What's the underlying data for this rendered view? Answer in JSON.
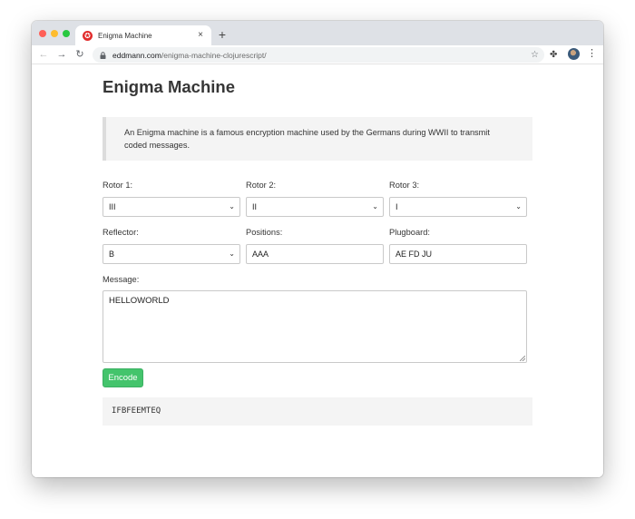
{
  "browser": {
    "tab_title": "Enigma Machine",
    "tab_close": "×",
    "new_tab": "+",
    "url_host": "eddmann.com",
    "url_path": "/enigma-machine-clojurescript/",
    "icons": {
      "back": "arrow-left",
      "forward": "arrow-right",
      "reload": "reload",
      "lock": "lock",
      "bookmark": "star",
      "extensions": "puzzle",
      "profile": "avatar",
      "menu": "kebab-menu"
    },
    "glyphs": {
      "back": "←",
      "forward": "→",
      "reload": "↻",
      "star": "☆",
      "ext": "✤",
      "menu": "⋮",
      "favicon": "✪"
    }
  },
  "page": {
    "title": "Enigma Machine",
    "intro": "An Enigma machine is a famous encryption machine used by the Germans during WWII to transmit coded messages."
  },
  "form": {
    "rotor1": {
      "label": "Rotor 1:",
      "value": "III"
    },
    "rotor2": {
      "label": "Rotor 2:",
      "value": "II"
    },
    "rotor3": {
      "label": "Rotor 3:",
      "value": "I"
    },
    "reflector": {
      "label": "Reflector:",
      "value": "B"
    },
    "positions": {
      "label": "Positions:",
      "value": "AAA"
    },
    "plugboard": {
      "label": "Plugboard:",
      "value": "AE FD JU"
    },
    "message": {
      "label": "Message:",
      "value": "HELLOWORLD"
    },
    "encode_label": "Encode",
    "output": "IFBFEEMTEQ",
    "select_caret": "⌄"
  },
  "colors": {
    "encode_button": "#44c46c",
    "favicon": "#e12c2c"
  }
}
